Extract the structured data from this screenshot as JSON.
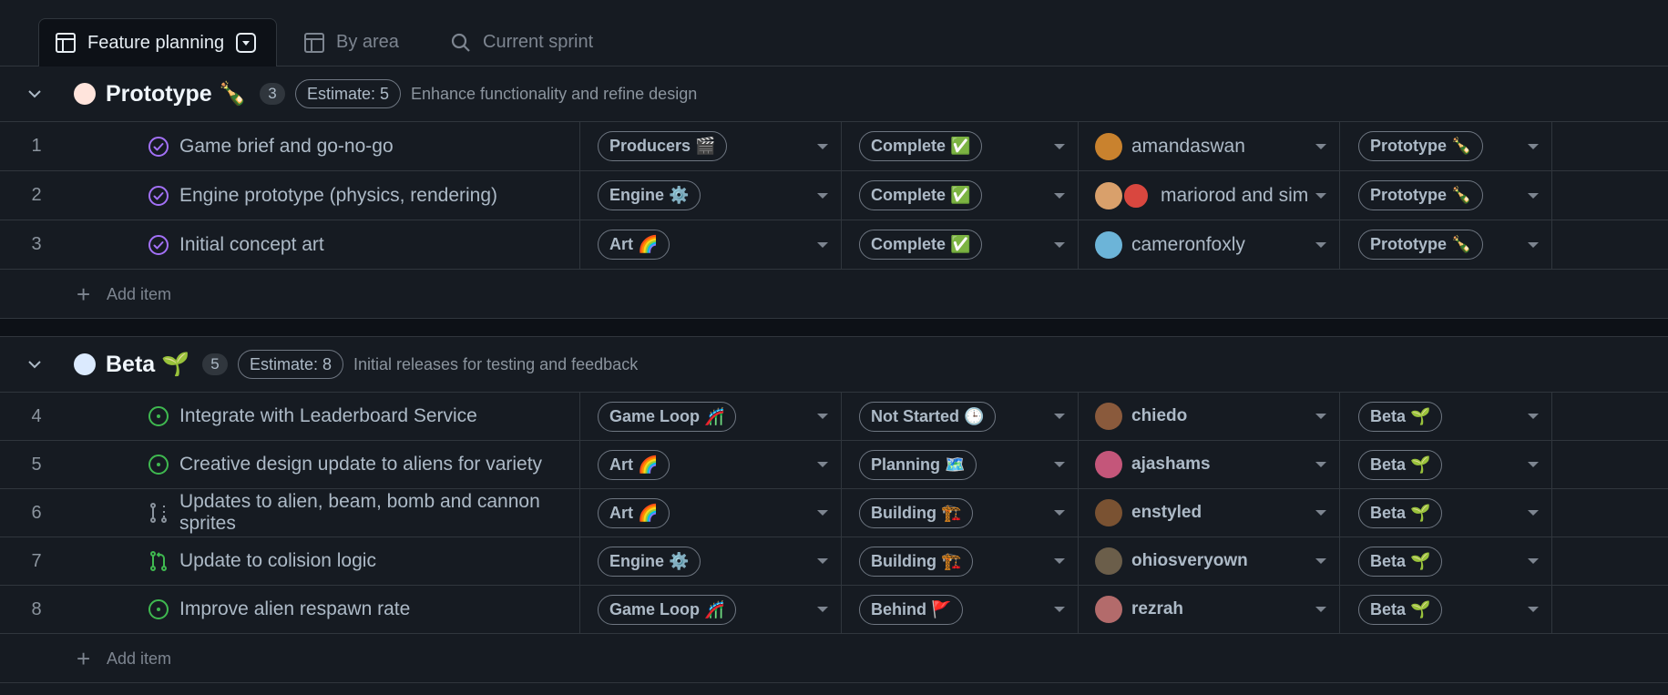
{
  "tabs": [
    {
      "label": "Feature planning",
      "icon": "table-icon",
      "active": true
    },
    {
      "label": "By area",
      "icon": "board-icon",
      "active": false
    },
    {
      "label": "Current sprint",
      "icon": "search-icon",
      "active": false
    }
  ],
  "groups": [
    {
      "title": "Prototype 🍾",
      "count": "3",
      "estimate": "Estimate: 5",
      "description": "Enhance functionality and refine design",
      "dot_color": "#ffe4dc",
      "add_label": "Add item",
      "rows": [
        {
          "num": "1",
          "title": "Game brief and go-no-go",
          "status_icon": "done-icon",
          "area": "Producers 🎬",
          "status": "Complete ✅",
          "assignee": "amandaswan",
          "iteration": "Prototype 🍾"
        },
        {
          "num": "2",
          "title": "Engine prototype (physics, rendering)",
          "status_icon": "done-icon",
          "area": "Engine ⚙️",
          "status": "Complete ✅",
          "assignee": "mariorod and sim",
          "iteration": "Prototype 🍾"
        },
        {
          "num": "3",
          "title": "Initial concept art",
          "status_icon": "done-icon",
          "area": "Art 🌈",
          "status": "Complete ✅",
          "assignee": "cameronfoxly",
          "iteration": "Prototype 🍾"
        }
      ]
    },
    {
      "title": "Beta 🌱",
      "count": "5",
      "estimate": "Estimate: 8",
      "description": "Initial releases for testing and feedback",
      "dot_color": "#dbeafe",
      "add_label": "Add item",
      "rows": [
        {
          "num": "4",
          "title": "Integrate with Leaderboard Service",
          "status_icon": "open-issue-icon",
          "area": "Game Loop 🎢",
          "status": "Not Started 🕒",
          "assignee": "chiedo",
          "iteration": "Beta 🌱"
        },
        {
          "num": "5",
          "title": "Creative design update to aliens for variety",
          "status_icon": "open-issue-icon",
          "area": "Art 🌈",
          "status": "Planning 🗺️",
          "assignee": "ajashams",
          "iteration": "Beta 🌱"
        },
        {
          "num": "6",
          "title": "Updates to alien, beam, bomb and cannon sprites",
          "status_icon": "draft-pr-icon",
          "area": "Art 🌈",
          "status": "Building 🏗️",
          "assignee": "enstyled",
          "iteration": "Beta 🌱"
        },
        {
          "num": "7",
          "title": "Update to colision logic",
          "status_icon": "open-pr-icon",
          "area": "Engine ⚙️",
          "status": "Building 🏗️",
          "assignee": "ohiosveryown",
          "iteration": "Beta 🌱"
        },
        {
          "num": "8",
          "title": "Improve alien respawn rate",
          "status_icon": "open-issue-icon",
          "area": "Game Loop 🎢",
          "status": "Behind 🚩",
          "assignee": "rezrah",
          "iteration": "Beta 🌱"
        }
      ]
    }
  ]
}
